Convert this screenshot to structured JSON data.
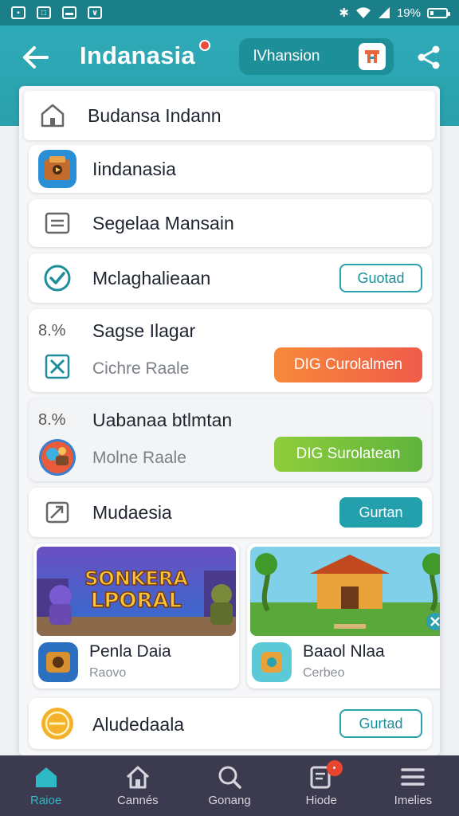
{
  "status": {
    "battery": "19%"
  },
  "header": {
    "title": "Indanasia",
    "search_value": "lVhansion"
  },
  "rows": [
    {
      "label": "Budansa Indann"
    },
    {
      "label": "Iindanasia"
    },
    {
      "label": "Segelaa Mansain"
    },
    {
      "label": "Mclaghalieaan",
      "action": "Guotad"
    },
    {
      "pct": "8.%",
      "label": "Sagse Ilagar",
      "sub": "Cichre Raale",
      "action": "DIG Curolalmen"
    },
    {
      "pct": "8.%",
      "label": "Uabanaa btlmtan",
      "sub": "Molne Raale",
      "action": "DIG Surolatean"
    },
    {
      "label": "Mudaesia",
      "action": "Gurtan"
    },
    {
      "label": "Aludedaala",
      "action": "Gurtad"
    }
  ],
  "cards": [
    {
      "art_text_1": "SONKERA",
      "art_text_2": "LPORAL",
      "name": "Penla Daia",
      "sub": "Raovo"
    },
    {
      "name": "Baaol Nlaa",
      "sub": "Cerbeo"
    }
  ],
  "nav": [
    {
      "label": "Raioe",
      "icon": "home-icon"
    },
    {
      "label": "Cannés",
      "icon": "house-icon"
    },
    {
      "label": "Gonang",
      "icon": "search-icon"
    },
    {
      "label": "Hiode",
      "icon": "notes-icon"
    },
    {
      "label": "Imelies",
      "icon": "menu-icon"
    }
  ],
  "colors": {
    "accent": "#2aa1ad",
    "orange_start": "#f7893a",
    "orange_end": "#f05b4a",
    "green_start": "#8fcd3b",
    "green_end": "#5fb43c",
    "nav_bg": "#3c3a4e"
  }
}
